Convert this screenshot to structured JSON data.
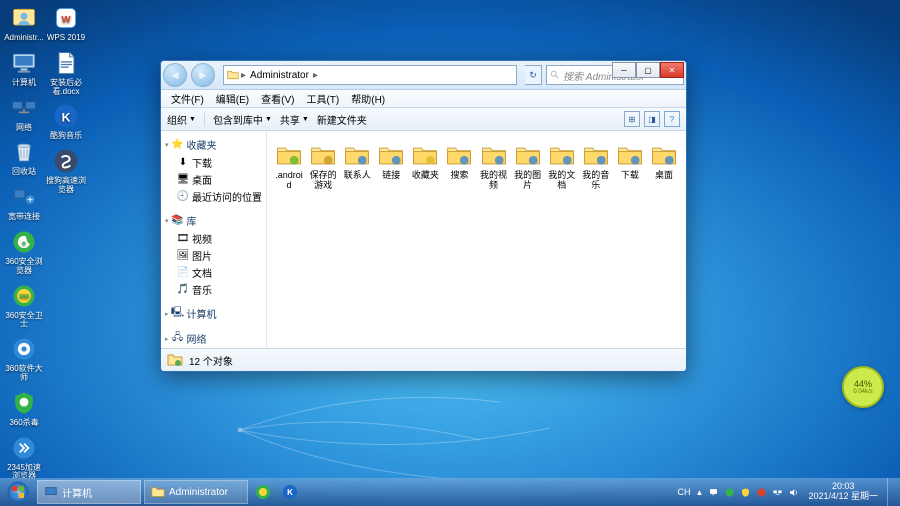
{
  "desktop_icons_col1": [
    {
      "label": "Administr...",
      "icon": "user"
    },
    {
      "label": "计算机",
      "icon": "computer"
    },
    {
      "label": "网络",
      "icon": "network"
    },
    {
      "label": "回收站",
      "icon": "recycle"
    },
    {
      "label": "宽带连接",
      "icon": "connection"
    },
    {
      "label": "360安全浏览器",
      "icon": "360browser"
    },
    {
      "label": "360安全卫士",
      "icon": "360safe"
    },
    {
      "label": "360软件大师",
      "icon": "360soft"
    },
    {
      "label": "360杀毒",
      "icon": "360av"
    },
    {
      "label": "2345加速浏览器",
      "icon": "2345"
    }
  ],
  "desktop_icons_col2": [
    {
      "label": "WPS 2019",
      "icon": "wps"
    },
    {
      "label": "安装后必看.docx",
      "icon": "docx"
    },
    {
      "label": "酷狗音乐",
      "icon": "kugou"
    },
    {
      "label": "搜狗高速浏览器",
      "icon": "sogou"
    }
  ],
  "window": {
    "address_segments": [
      "Administrator"
    ],
    "search_placeholder": "搜索 Administrator",
    "menus": [
      "文件(F)",
      "编辑(E)",
      "查看(V)",
      "工具(T)",
      "帮助(H)"
    ],
    "toolbar": {
      "organize": "组织",
      "include": "包含到库中",
      "share": "共享",
      "newfolder": "新建文件夹"
    },
    "sidebar": {
      "fav": {
        "title": "收藏夹",
        "items": [
          "下载",
          "桌面",
          "最近访问的位置"
        ]
      },
      "lib": {
        "title": "库",
        "items": [
          "视频",
          "图片",
          "文档",
          "音乐"
        ]
      },
      "computer": "计算机",
      "network": "网络"
    },
    "folders": [
      ".android",
      "保存的游戏",
      "联系人",
      "链接",
      "收藏夹",
      "搜索",
      "我的视频",
      "我的图片",
      "我的文档",
      "我的音乐",
      "下载",
      "桌面"
    ],
    "status": "12 个对象"
  },
  "speed_badge": {
    "pct": "44%",
    "rate": "0.04k/s"
  },
  "taskbar": {
    "task1": "计算机",
    "task2": "Administrator",
    "ime": "CH",
    "time": "20:03",
    "date": "2021/4/12 星期一"
  }
}
